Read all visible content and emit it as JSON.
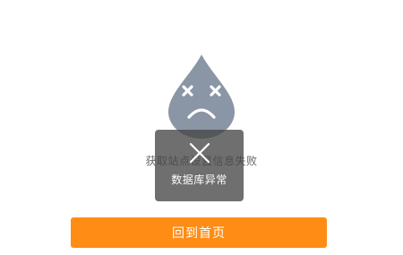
{
  "error": {
    "message": "获取站点设置信息失败",
    "illustration_icon": "sad-water-drop-icon",
    "illustration_color": "#8a96a6"
  },
  "toast": {
    "icon": "close-icon",
    "text": "数据库异常"
  },
  "actions": {
    "home_label": "回到首页",
    "home_color": "#ff8c14"
  }
}
